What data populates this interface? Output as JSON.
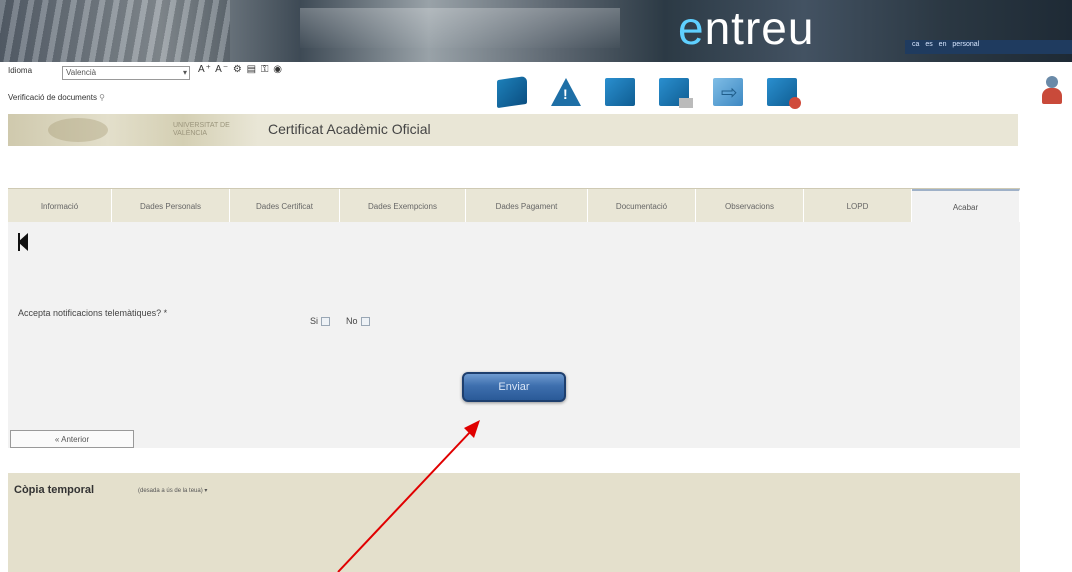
{
  "banner": {
    "brand_prefix": "e",
    "brand_rest": "ntreu",
    "links": "ca es en personal"
  },
  "toolbar": {
    "idioma_label": "Idioma",
    "idioma_value": "Valencià",
    "accessibility_tools": "A⁺ A⁻ ⚙ ▤ ⚿ ◉",
    "verificacio_label": "Verificació de documents"
  },
  "title": {
    "university_text": "UNIVERSITAT DE VALÈNCIA",
    "page_title": "Certificat Acadèmic Oficial"
  },
  "tabs": [
    {
      "label": "Informació"
    },
    {
      "label": "Dades Personals"
    },
    {
      "label": "Dades Certificat"
    },
    {
      "label": "Dades Exempcions"
    },
    {
      "label": "Dades Pagament"
    },
    {
      "label": "Documentació"
    },
    {
      "label": "Observacions"
    },
    {
      "label": "LOPD"
    },
    {
      "label": "Acabar"
    }
  ],
  "form": {
    "question": "Accepta notificacions telemàtiques? *",
    "opt_si": "Si",
    "opt_no": "No",
    "send_label": "Enviar",
    "prev_label": "« Anterior"
  },
  "temp": {
    "title": "Còpia temporal",
    "note": "(desada a ús de la teua)",
    "toggle": "▾"
  },
  "colors": {
    "accent": "#3e6fae",
    "brand": "#5fd0ff",
    "annotation": "#e00000"
  }
}
